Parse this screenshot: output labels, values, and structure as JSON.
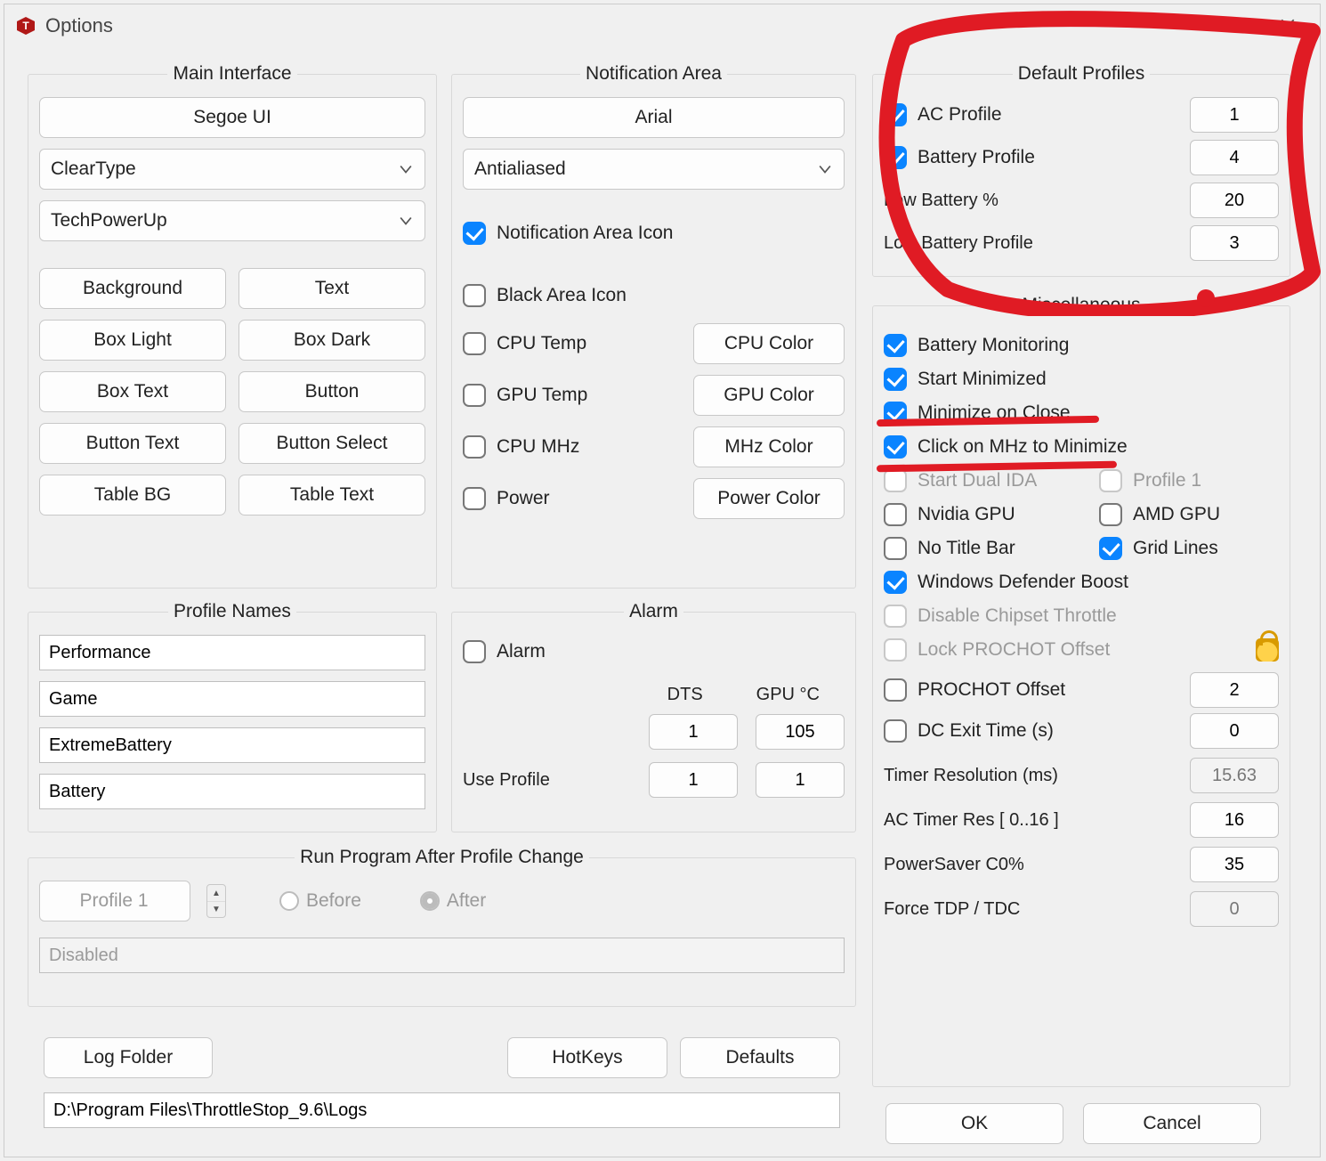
{
  "title": "Options",
  "main_interface": {
    "legend": "Main Interface",
    "font_button": "Segoe UI",
    "render_select": "ClearType",
    "theme_select": "TechPowerUp",
    "buttons": {
      "background": "Background",
      "text": "Text",
      "box_light": "Box Light",
      "box_dark": "Box Dark",
      "box_text": "Box Text",
      "button": "Button",
      "button_text": "Button Text",
      "button_select": "Button Select",
      "table_bg": "Table BG",
      "table_text": "Table Text"
    }
  },
  "notification_area": {
    "legend": "Notification Area",
    "font_button": "Arial",
    "aa_select": "Antialiased",
    "icon": {
      "label": "Notification Area Icon",
      "on": true
    },
    "black": {
      "label": "Black Area Icon",
      "on": false
    },
    "cpu_temp": {
      "label": "CPU Temp",
      "on": false
    },
    "gpu_temp": {
      "label": "GPU Temp",
      "on": false
    },
    "cpu_mhz": {
      "label": "CPU MHz",
      "on": false
    },
    "power": {
      "label": "Power",
      "on": false
    },
    "cpu_color": "CPU Color",
    "gpu_color": "GPU Color",
    "mhz_color": "MHz Color",
    "power_color": "Power Color"
  },
  "profile_names": {
    "legend": "Profile Names",
    "p1": "Performance",
    "p2": "Game",
    "p3": "ExtremeBattery",
    "p4": "Battery"
  },
  "alarm": {
    "legend": "Alarm",
    "enable": {
      "label": "Alarm",
      "on": false
    },
    "dts_label": "DTS",
    "gpu_label": "GPU °C",
    "dts_value": "1",
    "gpu_value": "105",
    "use_profile_label": "Use Profile",
    "use_dts": "1",
    "use_gpu": "1"
  },
  "run_after": {
    "legend": "Run Program After Profile Change",
    "profile_select": "Profile 1",
    "before": "Before",
    "after": "After",
    "path": "Disabled"
  },
  "bottom": {
    "log_folder": "Log Folder",
    "hotkeys": "HotKeys",
    "defaults": "Defaults",
    "log_path": "D:\\Program Files\\ThrottleStop_9.6\\Logs"
  },
  "default_profiles": {
    "legend": "Default Profiles",
    "ac": {
      "label": "AC Profile",
      "on": true,
      "value": "1"
    },
    "batt": {
      "label": "Battery Profile",
      "on": true,
      "value": "4"
    },
    "low_pct": {
      "label": "Low Battery %",
      "value": "20"
    },
    "low_prof": {
      "label": "Low Battery Profile",
      "value": "3"
    }
  },
  "misc": {
    "legend": "Miscellaneous",
    "batt_mon": {
      "label": "Battery Monitoring",
      "on": true
    },
    "start_min": {
      "label": "Start Minimized",
      "on": true
    },
    "min_close": {
      "label": "Minimize on Close",
      "on": true
    },
    "click_min": {
      "label": "Click on MHz to Minimize",
      "on": true
    },
    "dual_ida": {
      "label": "Start Dual IDA",
      "on": false
    },
    "profile1": {
      "label": "Profile 1",
      "on": false
    },
    "nvidia": {
      "label": "Nvidia GPU",
      "on": false
    },
    "amd": {
      "label": "AMD GPU",
      "on": false
    },
    "no_title": {
      "label": "No Title Bar",
      "on": false
    },
    "grid": {
      "label": "Grid Lines",
      "on": true
    },
    "wdb": {
      "label": "Windows Defender Boost",
      "on": true
    },
    "dis_throt": {
      "label": "Disable Chipset Throttle",
      "on": false
    },
    "lock_prochot": {
      "label": "Lock PROCHOT Offset",
      "on": false
    },
    "prochot": {
      "label": "PROCHOT Offset",
      "on": false,
      "value": "2"
    },
    "dc_exit": {
      "label": "DC Exit Time (s)",
      "on": false,
      "value": "0"
    },
    "timer_res": {
      "label": "Timer Resolution (ms)",
      "value": "15.63"
    },
    "ac_timer": {
      "label": "AC Timer Res [ 0..16 ]",
      "value": "16"
    },
    "c0": {
      "label": "PowerSaver C0%",
      "value": "35"
    },
    "tdp": {
      "label": "Force TDP / TDC",
      "value": "0"
    }
  },
  "footer": {
    "ok": "OK",
    "cancel": "Cancel"
  }
}
